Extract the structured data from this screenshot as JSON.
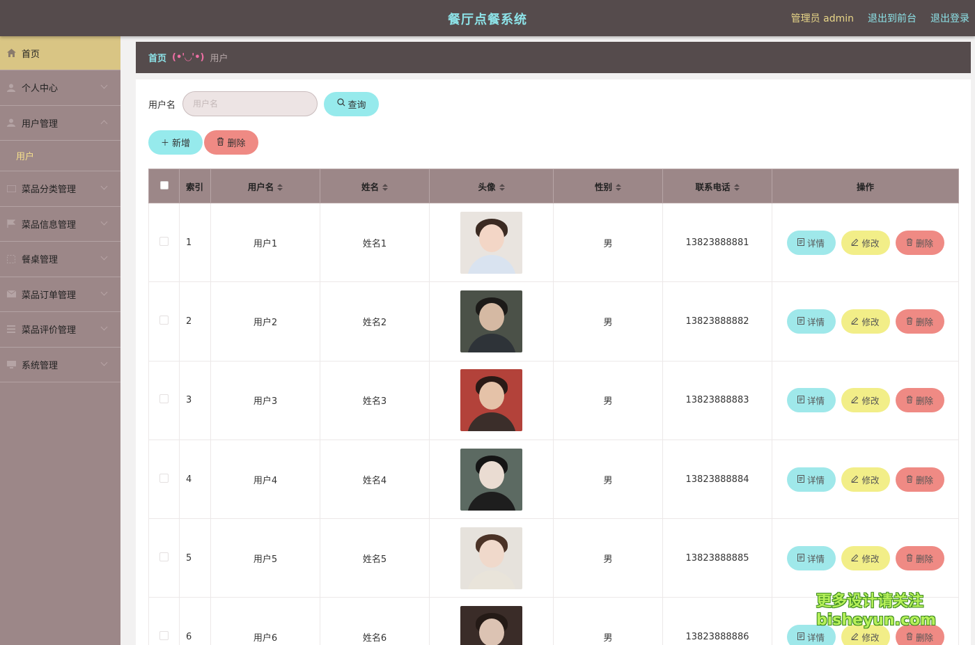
{
  "header": {
    "title": "餐厅点餐系统",
    "admin_label": "管理员 admin",
    "front_label": "退出到前台",
    "logout_label": "退出登录"
  },
  "sidebar": {
    "items": [
      {
        "label": "首页",
        "icon": "home-icon"
      },
      {
        "label": "个人中心",
        "icon": "user-icon"
      },
      {
        "label": "用户管理",
        "icon": "user-icon"
      },
      {
        "label": "菜品分类管理",
        "icon": "card-icon"
      },
      {
        "label": "菜品信息管理",
        "icon": "flag-icon"
      },
      {
        "label": "餐桌管理",
        "icon": "table-icon"
      },
      {
        "label": "菜品订单管理",
        "icon": "mail-icon"
      },
      {
        "label": "菜品评价管理",
        "icon": "list-icon"
      },
      {
        "label": "系统管理",
        "icon": "monitor-icon"
      }
    ],
    "submenu_user": "用户"
  },
  "breadcrumb": {
    "home": "首页",
    "separator": "(•'◡'•)",
    "current": "用户"
  },
  "search": {
    "label": "用户名",
    "placeholder": "用户名",
    "query_label": "查询"
  },
  "actions": {
    "add_label": "新增",
    "delete_label": "删除"
  },
  "table": {
    "headers": [
      "索引",
      "用户名",
      "姓名",
      "头像",
      "性别",
      "联系电话",
      "操作"
    ],
    "rows": [
      {
        "index": "1",
        "username": "用户1",
        "name": "姓名1",
        "gender": "男",
        "phone": "13823888881"
      },
      {
        "index": "2",
        "username": "用户2",
        "name": "姓名2",
        "gender": "男",
        "phone": "13823888882"
      },
      {
        "index": "3",
        "username": "用户3",
        "name": "姓名3",
        "gender": "男",
        "phone": "13823888883"
      },
      {
        "index": "4",
        "username": "用户4",
        "name": "姓名4",
        "gender": "男",
        "phone": "13823888884"
      },
      {
        "index": "5",
        "username": "用户5",
        "name": "姓名5",
        "gender": "男",
        "phone": "13823888885"
      },
      {
        "index": "6",
        "username": "用户6",
        "name": "姓名6",
        "gender": "男",
        "phone": "13823888886"
      }
    ],
    "row_actions": {
      "detail": "详情",
      "edit": "修改",
      "delete": "删除"
    }
  },
  "watermark": {
    "line1": "更多设计请关注",
    "line2": "bisheyun.com"
  },
  "colors": {
    "header_bg": "#554b4c",
    "sidebar_bg": "#9c8788",
    "active_item": "#d9c584",
    "accent_cyan": "#96eaec",
    "accent_yellow": "#f2ee88",
    "accent_red": "#ef8a84"
  }
}
